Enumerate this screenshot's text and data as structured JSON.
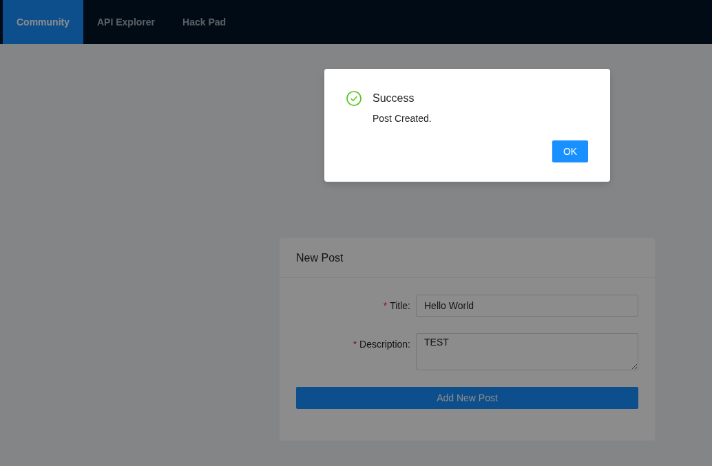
{
  "nav": {
    "tabs": [
      {
        "label": "Community",
        "selected": true
      },
      {
        "label": "API Explorer",
        "selected": false
      },
      {
        "label": "Hack Pad",
        "selected": false
      }
    ]
  },
  "new_post": {
    "title": "New Post",
    "fields": [
      {
        "kind": "input",
        "required_mark": "*",
        "label": "Title:",
        "value": "Hello World"
      },
      {
        "kind": "textarea",
        "required_mark": "*",
        "label": "Description:",
        "value": "TEST"
      }
    ],
    "submit": "Add New Post"
  },
  "modal": {
    "title": "Success",
    "message": "Post Created.",
    "button": "OK"
  }
}
